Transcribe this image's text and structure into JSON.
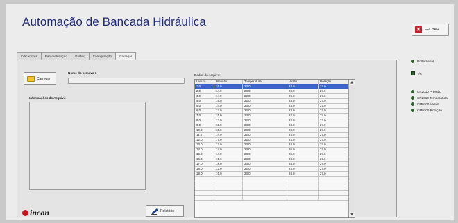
{
  "app": {
    "title": "Automação de Bancada Hidráulica"
  },
  "header": {
    "fechar_label": "FECHAR"
  },
  "tabs": [
    {
      "label": "Indicadores",
      "active": false
    },
    {
      "label": "Parametrização",
      "active": false
    },
    {
      "label": "Gráfico",
      "active": false
    },
    {
      "label": "Configuração",
      "active": false
    },
    {
      "label": "Carregar",
      "active": true
    }
  ],
  "carregar": {
    "button_label": "Carregar",
    "nome_arquivo_label": "Nome do arquivo 1",
    "nome_arquivo_value": "",
    "info_label": "Informações do Arquivo",
    "info_value": "",
    "relatorio_label": "Relatório",
    "dados_label": "Dados do Arquivo:"
  },
  "table": {
    "columns": [
      "Leitura",
      "Pressão",
      "Temperatura",
      "Vazão",
      "Rotação"
    ],
    "rows": [
      [
        "1.0",
        "15.0",
        "23.0",
        "23.0",
        "27.0"
      ],
      [
        "2.0",
        "14.0",
        "23.0",
        "23.0",
        "27.0"
      ],
      [
        "3.0",
        "14.0",
        "22.0",
        "25.0",
        "27.0"
      ],
      [
        "4.0",
        "15.0",
        "22.0",
        "24.0",
        "27.0"
      ],
      [
        "5.0",
        "14.0",
        "23.0",
        "23.0",
        "27.0"
      ],
      [
        "6.0",
        "13.0",
        "22.0",
        "23.0",
        "27.0"
      ],
      [
        "7.0",
        "15.0",
        "23.0",
        "23.0",
        "27.0"
      ],
      [
        "8.0",
        "13.0",
        "22.0",
        "23.0",
        "27.0"
      ],
      [
        "9.0",
        "13.0",
        "23.0",
        "23.0",
        "27.0"
      ],
      [
        "10.0",
        "15.0",
        "23.0",
        "23.0",
        "27.0"
      ],
      [
        "11.0",
        "14.0",
        "22.0",
        "23.0",
        "27.0"
      ],
      [
        "12.0",
        "17.0",
        "22.0",
        "23.0",
        "27.0"
      ],
      [
        "13.0",
        "13.0",
        "23.0",
        "24.0",
        "27.0"
      ],
      [
        "14.0",
        "14.0",
        "23.0",
        "26.0",
        "27.0"
      ],
      [
        "15.0",
        "14.0",
        "23.0",
        "25.0",
        "27.0"
      ],
      [
        "16.0",
        "15.0",
        "23.0",
        "23.0",
        "27.0"
      ],
      [
        "17.0",
        "18.0",
        "23.0",
        "24.0",
        "27.0"
      ],
      [
        "18.0",
        "13.0",
        "22.0",
        "23.0",
        "27.0"
      ],
      [
        "19.0",
        "15.0",
        "23.0",
        "24.0",
        "27.0"
      ]
    ],
    "selected_row": 0
  },
  "status": {
    "porta_serial": "Porta Serial",
    "ir_label": "I/R",
    "sensors": [
      "CR2010 Pressão",
      "CR2010 Temperatura",
      "CM9100 Vazão",
      "CM9100 Rotação"
    ]
  },
  "logo": {
    "text": "incon"
  },
  "colors": {
    "title": "#1f2b78",
    "close_red": "#c0202a",
    "selected_row": "#3b64c8",
    "led_green": "#2f5e2f"
  },
  "icons": {
    "fechar": "close-x-icon",
    "carregar": "folder-icon",
    "relatorio": "pen-icon"
  }
}
